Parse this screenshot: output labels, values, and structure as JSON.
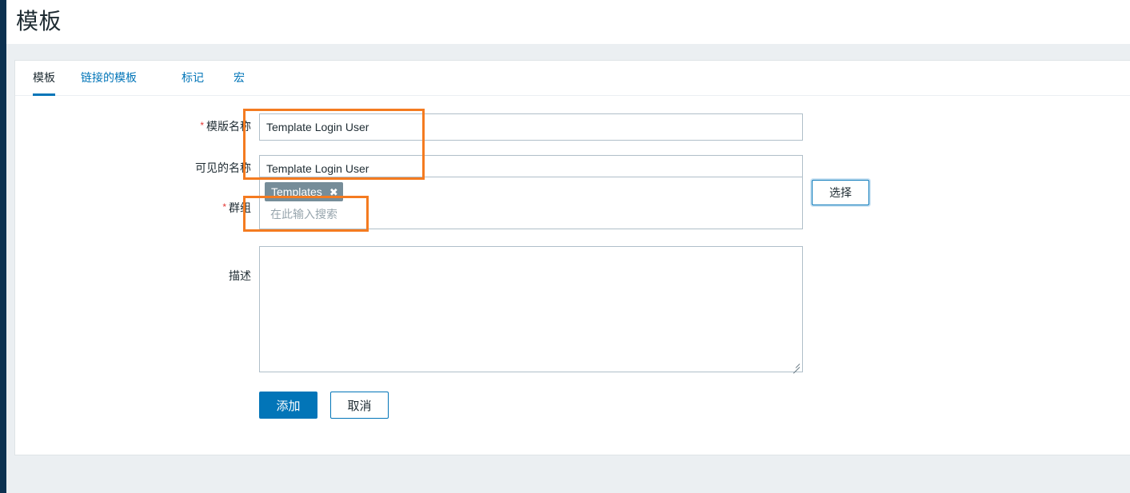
{
  "page": {
    "title": "模板",
    "background_color": "#ebeff2",
    "accent_color": "#0275b8",
    "annotation_color": "#f47b20"
  },
  "tabs": [
    {
      "label": "模板",
      "active": true
    },
    {
      "label": "链接的模板",
      "active": false
    },
    {
      "label": "标记",
      "active": false
    },
    {
      "label": "宏",
      "active": false
    }
  ],
  "form": {
    "template_name": {
      "label": "模版名称",
      "required": true,
      "value": "Template Login User",
      "placeholder": ""
    },
    "visible_name": {
      "label": "可见的名称",
      "required": false,
      "value": "Template Login User",
      "placeholder": ""
    },
    "groups": {
      "label": "群组",
      "required": true,
      "chips": [
        {
          "label": "Templates",
          "remove_icon": "close-icon"
        }
      ],
      "placeholder": "在此输入搜索",
      "select_button": "选择"
    },
    "description": {
      "label": "描述",
      "required": false,
      "value": "",
      "placeholder": ""
    }
  },
  "actions": {
    "submit_label": "添加",
    "cancel_label": "取消"
  }
}
